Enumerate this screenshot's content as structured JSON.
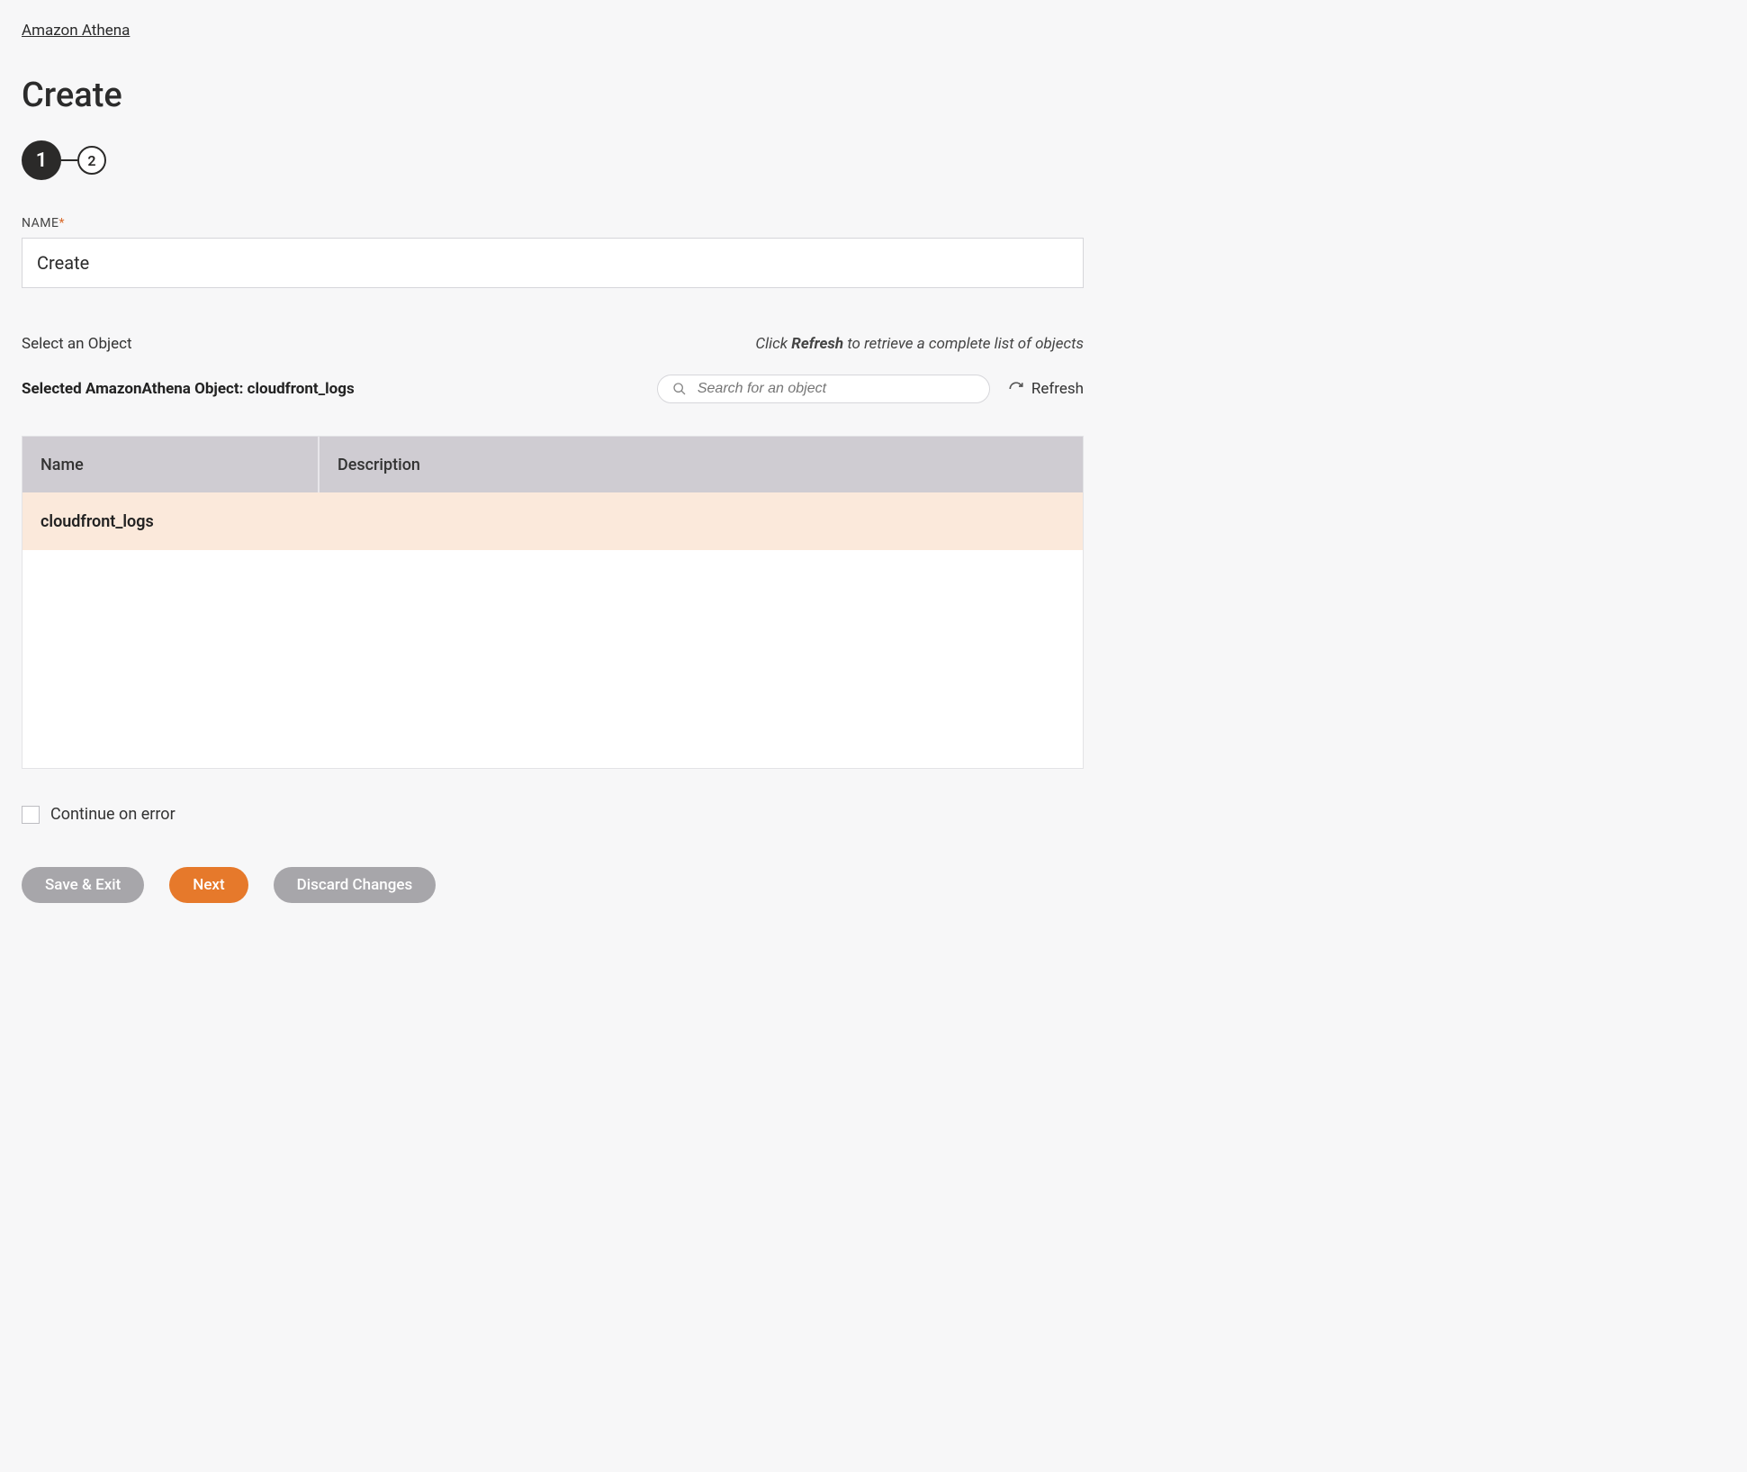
{
  "breadcrumb": {
    "label": "Amazon Athena"
  },
  "page": {
    "title": "Create"
  },
  "stepper": {
    "current": "1",
    "next": "2"
  },
  "name_field": {
    "label": "NAME",
    "value": "Create"
  },
  "object_section": {
    "label": "Select an Object",
    "hint_prefix": "Click ",
    "hint_bold": "Refresh",
    "hint_suffix": " to retrieve a complete list of objects",
    "selected_label": "Selected AmazonAthena Object: cloudfront_logs"
  },
  "search": {
    "placeholder": "Search for an object"
  },
  "refresh": {
    "label": "Refresh"
  },
  "table": {
    "headers": {
      "name": "Name",
      "description": "Description"
    },
    "rows": [
      {
        "name": "cloudfront_logs",
        "description": ""
      }
    ]
  },
  "continue_on_error": {
    "label": "Continue on error"
  },
  "buttons": {
    "save_exit": "Save & Exit",
    "next": "Next",
    "discard": "Discard Changes"
  }
}
